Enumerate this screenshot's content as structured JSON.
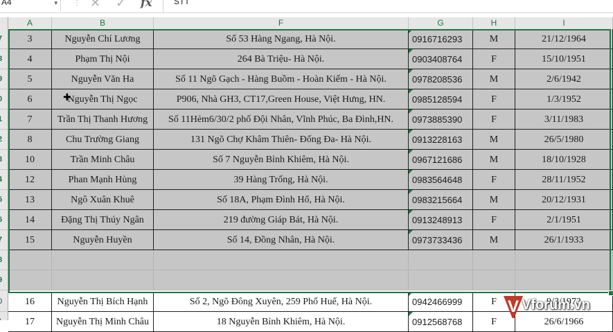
{
  "formula_bar": {
    "name_box": "A4",
    "cancel_symbol": "✕",
    "enter_symbol": "✓",
    "fx_label": "fx",
    "value": "STT"
  },
  "columns": [
    {
      "letter": "A",
      "width": 63
    },
    {
      "letter": "B",
      "width": 147
    },
    {
      "letter": "F",
      "width": 368
    },
    {
      "letter": "G",
      "width": 93
    },
    {
      "letter": "H",
      "width": 61
    },
    {
      "letter": "I",
      "width": 141
    }
  ],
  "row_numbers": [
    "7",
    "8",
    "9",
    "0",
    "1",
    "2",
    "3",
    "4",
    "5",
    "6",
    "7",
    "8",
    "9",
    "0",
    "1"
  ],
  "rows": [
    {
      "stt": "3",
      "name": "Nguyễn Chí Lương",
      "address": "Số 53 Hàng Ngang, Hà Nội.",
      "phone": "0916716293",
      "sex": "M",
      "dob": "21/12/1964"
    },
    {
      "stt": "4",
      "name": "Phạm Thị Nội",
      "address": "264 Bà Triệu- Hà Nội.",
      "phone": "0903408764",
      "sex": "F",
      "dob": "15/10/1951"
    },
    {
      "stt": "5",
      "name": "Nguyễn Văn Ha",
      "address": "Số 11 Ngõ Gạch - Hàng Buồm - Hoàn Kiếm - Hà Nội.",
      "phone": "0978208536",
      "sex": "M",
      "dob": "2/6/1942"
    },
    {
      "stt": "6",
      "name": "Nguyễn Thị Ngọc",
      "address": "P906, Nhà GH3, CT17,Green House, Việt Hưng, HN.",
      "phone": "0985128594",
      "sex": "F",
      "dob": "1/3/1952"
    },
    {
      "stt": "7",
      "name": "Trần Thị Thanh Hương",
      "address": "Số 11Hẻm6/30/2 phố Đội Nhân, Vĩnh Phúc, Ba Đình,HN.",
      "phone": "0973885390",
      "sex": "F",
      "dob": "3/11/1983"
    },
    {
      "stt": "8",
      "name": "Chu Trường Giang",
      "address": "131 Ngõ Chợ Khâm Thiên-  Đống Đa- Hà Nội.",
      "phone": "0913228163",
      "sex": "M",
      "dob": "26/5/1980"
    },
    {
      "stt": "10",
      "name": "Trần Minh Châu",
      "address": "Số 7 Nguyễn Bỉnh Khiêm, Hà Nội.",
      "phone": "0967121686",
      "sex": "M",
      "dob": "18/10/1928"
    },
    {
      "stt": "12",
      "name": "Phan Mạnh Hùng",
      "address": "39 Hàng Trống, Hà Nội.",
      "phone": "0983564648",
      "sex": "F",
      "dob": "28/11/1952"
    },
    {
      "stt": "13",
      "name": "Ngô  Xuân Khuê",
      "address": "Số 18A, Phạm Đình Hổ, Hà Nội.",
      "phone": "0983215664",
      "sex": "M",
      "dob": "20/12/1931"
    },
    {
      "stt": "14",
      "name": "Đặng Thị Thúy Ngân",
      "address": "219 đường Giáp Bát, Hà Nội.",
      "phone": "0913248913",
      "sex": "F",
      "dob": "2/1/1951"
    },
    {
      "stt": "15",
      "name": "Nguyễn Huyền",
      "address": "Số 14, Đồng Nhân, Hà Nội.",
      "phone": "0973733436",
      "sex": "M",
      "dob": "26/1/1933"
    },
    {
      "stt": "",
      "name": "",
      "address": "",
      "phone": "",
      "sex": "",
      "dob": ""
    },
    {
      "stt": "",
      "name": "",
      "address": "",
      "phone": "",
      "sex": "",
      "dob": ""
    },
    {
      "stt": "16",
      "name": "Nguyễn Thị Bích Hạnh",
      "address": "Số 2, Ngõ Đông Xuyên, 259 Phố Huế, Hà Nội.",
      "phone": "0942466999",
      "sex": "F",
      "dob": "9/3/1973"
    },
    {
      "stt": "17",
      "name": "Nguyễn Thị Minh Châu",
      "address": "18 Nguyễn Bỉnh Khiêm, Hà Nội.",
      "phone": "0912568768",
      "sex": "F",
      "dob": "26/6/1966"
    }
  ],
  "watermark": {
    "mark": "V",
    "text": "Vforum.vn",
    "color": "#c0392b"
  },
  "colors": {
    "accent": "#217346",
    "selection": "#c6c6c6"
  }
}
